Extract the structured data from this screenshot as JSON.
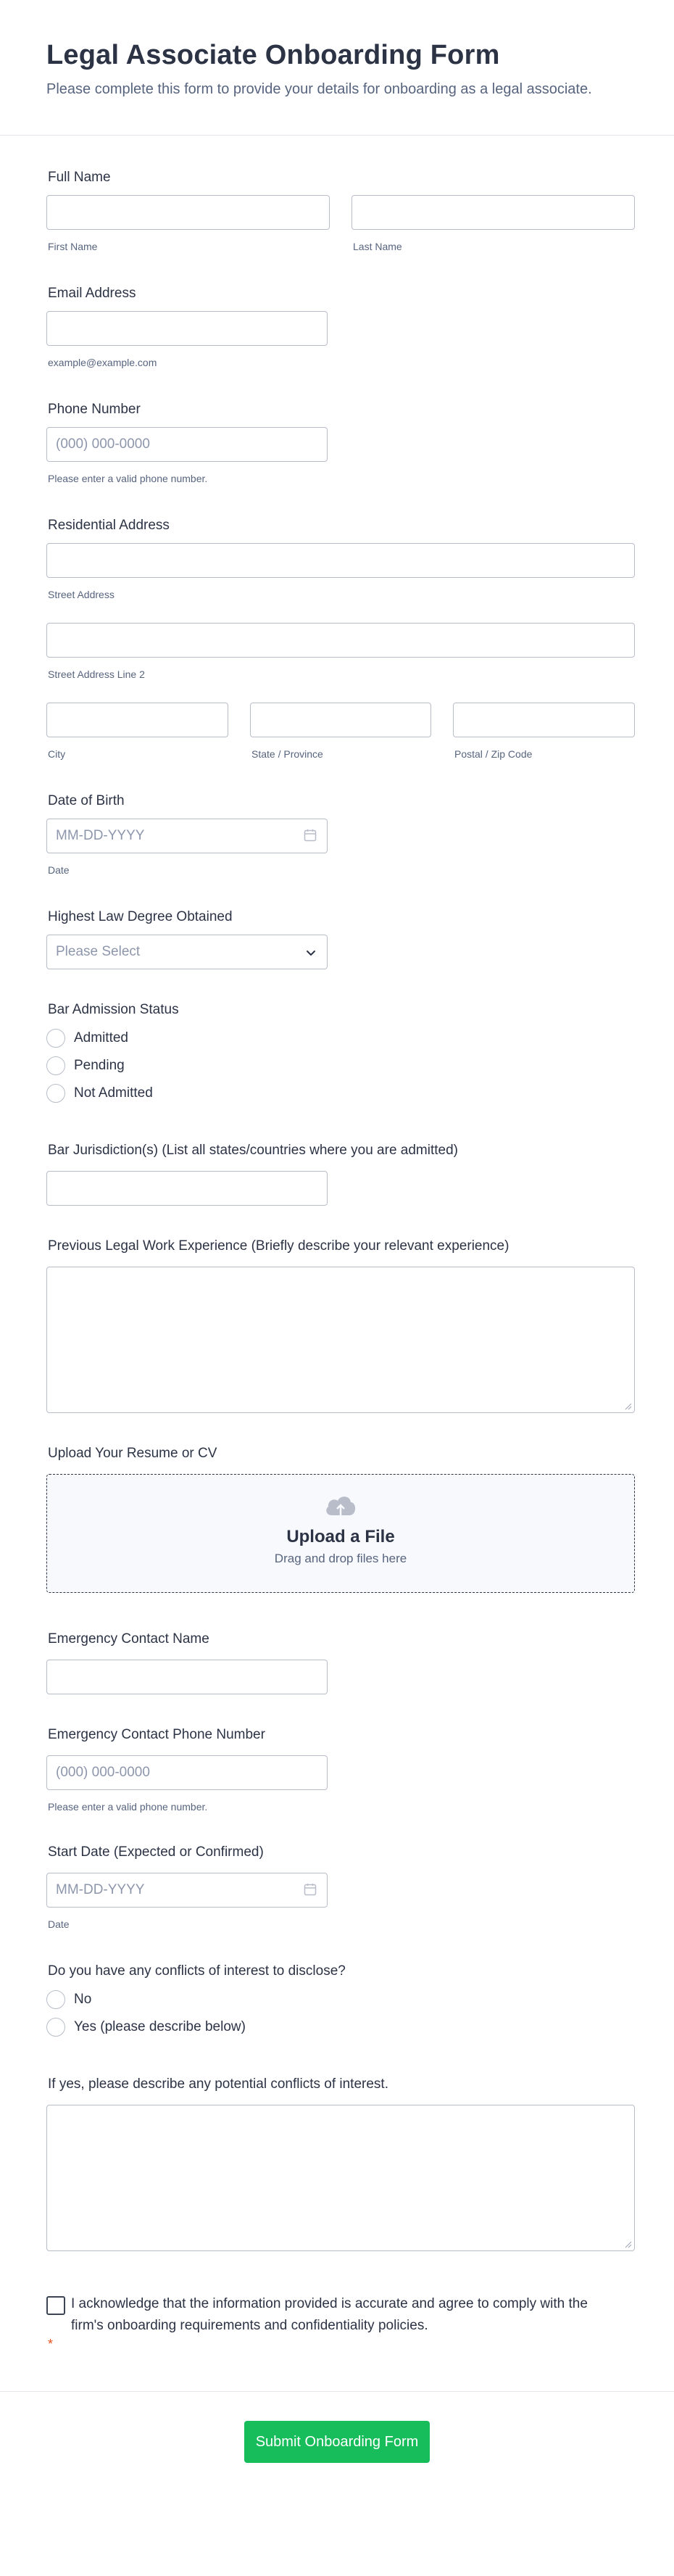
{
  "header": {
    "title": "Legal Associate Onboarding Form",
    "subtitle": "Please complete this form to provide your details for onboarding as a legal associate."
  },
  "full_name": {
    "label": "Full Name",
    "first_sub": "First Name",
    "last_sub": "Last Name",
    "first_value": "",
    "last_value": ""
  },
  "email": {
    "label": "Email Address",
    "sub": "example@example.com",
    "value": ""
  },
  "phone": {
    "label": "Phone Number",
    "placeholder": "(000) 000-0000",
    "sub": "Please enter a valid phone number."
  },
  "address": {
    "label": "Residential Address",
    "street_sub": "Street Address",
    "street2_sub": "Street Address Line 2",
    "city_sub": "City",
    "state_sub": "State / Province",
    "zip_sub": "Postal / Zip Code"
  },
  "dob": {
    "label": "Date of Birth",
    "placeholder": "MM-DD-YYYY",
    "sub": "Date",
    "icon": "calendar-icon"
  },
  "degree": {
    "label": "Highest Law Degree Obtained",
    "selected": "Please Select",
    "icon": "chevron-down-icon"
  },
  "bar_status": {
    "label": "Bar Admission Status",
    "options": [
      "Admitted",
      "Pending",
      "Not Admitted"
    ]
  },
  "jurisdiction": {
    "label": "Bar Jurisdiction(s) (List all states/countries where you are admitted)"
  },
  "experience": {
    "label": "Previous Legal Work Experience (Briefly describe your relevant experience)"
  },
  "upload": {
    "label": "Upload Your Resume or CV",
    "title": "Upload a File",
    "sub": "Drag and drop files here",
    "icon": "cloud-upload-icon"
  },
  "emergency_name": {
    "label": "Emergency Contact Name"
  },
  "emergency_phone": {
    "label": "Emergency Contact Phone Number",
    "placeholder": "(000) 000-0000",
    "sub": "Please enter a valid phone number."
  },
  "start_date": {
    "label": "Start Date (Expected or Confirmed)",
    "placeholder": "MM-DD-YYYY",
    "sub": "Date"
  },
  "conflicts": {
    "label": "Do you have any conflicts of interest to disclose?",
    "options": [
      "No",
      "Yes (please describe below)"
    ]
  },
  "conflicts_desc": {
    "label": "If yes, please describe any potential conflicts of interest."
  },
  "ack": {
    "text": "I acknowledge that the information provided is accurate and agree to comply with the firm's onboarding requirements and confidentiality policies.",
    "required_mark": "*"
  },
  "submit": {
    "label": "Submit Onboarding Form"
  },
  "colors": {
    "accent": "#18bd5b",
    "required": "#e8501e",
    "text": "#2c3345",
    "muted": "#57647e"
  }
}
